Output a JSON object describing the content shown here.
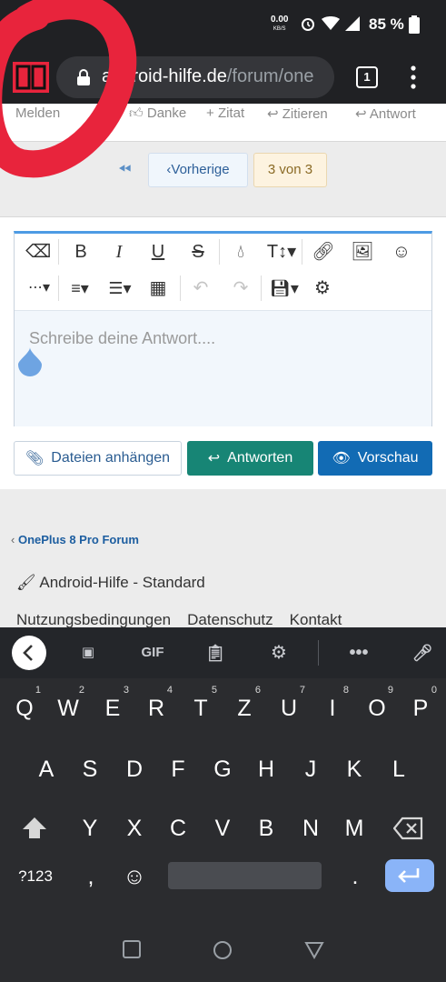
{
  "status": {
    "time": "",
    "speed": "0.00",
    "speed_unit": "KB/S",
    "battery": "85 %"
  },
  "browser": {
    "url_prefix": "a",
    "url_host": "ndroid-hilfe.de",
    "url_path": "/forum/one",
    "tab_count": "1"
  },
  "post_actions": {
    "report": "Melden",
    "thanks": "Danke",
    "add_quote": "Zitat",
    "quote": "Zitieren",
    "reply": "Antwort"
  },
  "pagination": {
    "previous": "Vorherige",
    "current": "3 von 3"
  },
  "editor": {
    "placeholder": "Schreibe deine Antwort...."
  },
  "buttons": {
    "attach": "Dateien anhängen",
    "reply": "Antworten",
    "preview": "Vorschau"
  },
  "footer": {
    "breadcrumb": "OnePlus 8 Pro Forum",
    "style": "Android-Hilfe - Standard",
    "links": [
      "Nutzungsbedingungen",
      "Datenschutz",
      "Kontakt"
    ]
  },
  "keyboard": {
    "gif_label": "GIF",
    "row1": [
      [
        "Q",
        "1"
      ],
      [
        "W",
        "2"
      ],
      [
        "E",
        "3"
      ],
      [
        "R",
        "4"
      ],
      [
        "T",
        "5"
      ],
      [
        "Z",
        "6"
      ],
      [
        "U",
        "7"
      ],
      [
        "I",
        "8"
      ],
      [
        "O",
        "9"
      ],
      [
        "P",
        "0"
      ]
    ],
    "row2": [
      "A",
      "S",
      "D",
      "F",
      "G",
      "H",
      "J",
      "K",
      "L"
    ],
    "row3": [
      "Y",
      "X",
      "C",
      "V",
      "B",
      "N",
      "M"
    ],
    "symbols": "?123",
    "comma": ",",
    "period": "."
  },
  "colors": {
    "accent_reply": "#178575",
    "accent_preview": "#126bb4",
    "link": "#1d5ea0",
    "annotation": "#e8243c"
  }
}
